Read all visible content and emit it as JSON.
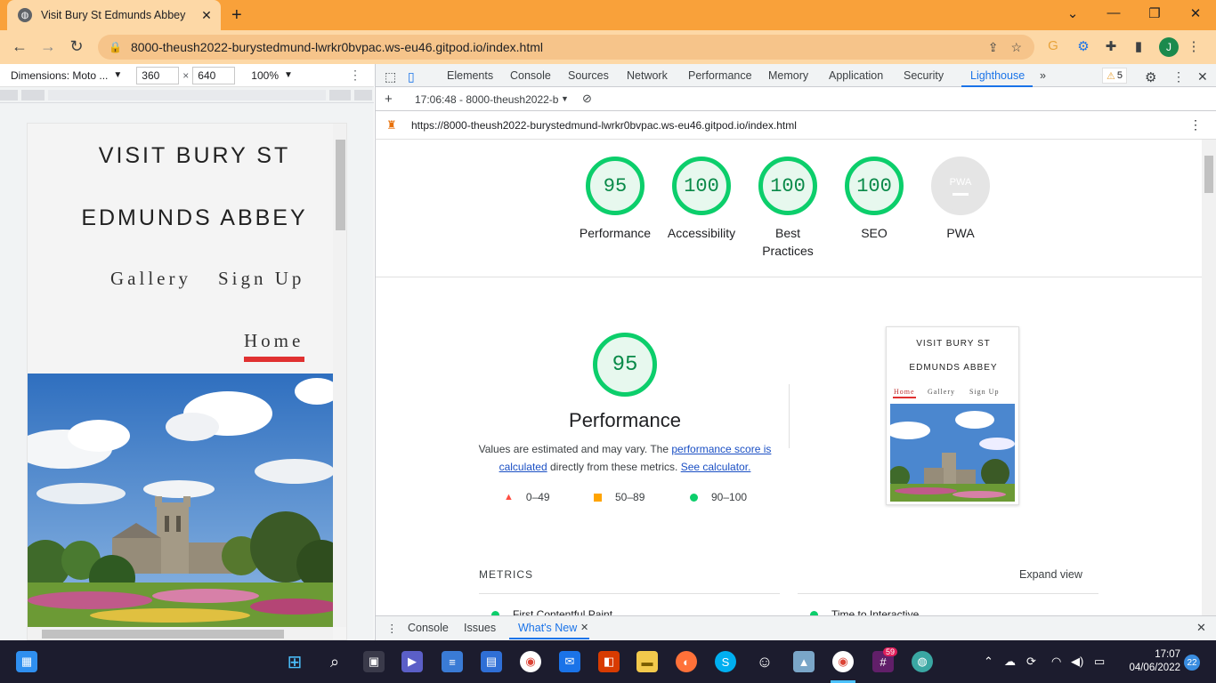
{
  "browser": {
    "tab_title": "Visit Bury St Edmunds Abbey",
    "url": "8000-theush2022-burystedmund-lwrkr0bvpac.ws-eu46.gitpod.io/index.html",
    "profile_initial": "J"
  },
  "device_toolbar": {
    "dimensions_label": "Dimensions: Moto ...",
    "width": "360",
    "height": "640",
    "zoom": "100%"
  },
  "site": {
    "title_line1": "VISIT BURY ST",
    "title_line2": "EDMUNDS ABBEY",
    "nav": [
      "Gallery",
      "Sign Up",
      "Home"
    ],
    "active_nav": "Home"
  },
  "devtools": {
    "tabs": [
      "Elements",
      "Console",
      "Sources",
      "Network",
      "Performance",
      "Memory",
      "Application",
      "Security",
      "Lighthouse"
    ],
    "active_tab": "Lighthouse",
    "warnings": "5",
    "report_selector": "17:06:48 - 8000-theush2022-b",
    "report_url": "https://8000-theush2022-burystedmund-lwrkr0bvpac.ws-eu46.gitpod.io/index.html"
  },
  "lighthouse": {
    "scores": [
      {
        "label": "Performance",
        "value": "95"
      },
      {
        "label": "Accessibility",
        "value": "100"
      },
      {
        "label": "Best Practices",
        "value": "100"
      },
      {
        "label": "SEO",
        "value": "100"
      },
      {
        "label": "PWA",
        "value": "PWA"
      }
    ],
    "performance_score": "95",
    "performance_title": "Performance",
    "desc_before": "Values are estimated and may vary. The ",
    "desc_link1": "performance score is calculated",
    "desc_middle": " directly from these metrics. ",
    "desc_link2": "See calculator.",
    "legend": [
      "0–49",
      "50–89",
      "90–100"
    ],
    "metrics_label": "METRICS",
    "expand_label": "Expand view",
    "metrics": [
      "First Contentful Paint",
      "Time to Interactive"
    ],
    "colors": {
      "pass": "#0cce6b",
      "average": "#ffa400",
      "fail": "#ff4e42"
    }
  },
  "drawer": {
    "tabs": [
      "Console",
      "Issues",
      "What's New"
    ],
    "active_tab": "What's New"
  },
  "taskbar": {
    "time": "17:07",
    "date": "04/06/2022",
    "notifications": "22",
    "slack_badge": "59"
  }
}
